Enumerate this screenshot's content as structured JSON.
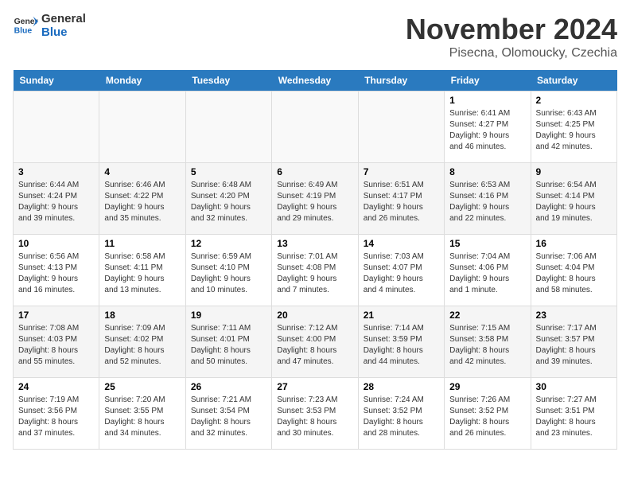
{
  "logo": {
    "line1": "General",
    "line2": "Blue"
  },
  "title": "November 2024",
  "subtitle": "Pisecna, Olomoucky, Czechia",
  "weekdays": [
    "Sunday",
    "Monday",
    "Tuesday",
    "Wednesday",
    "Thursday",
    "Friday",
    "Saturday"
  ],
  "weeks": [
    [
      {
        "day": "",
        "info": ""
      },
      {
        "day": "",
        "info": ""
      },
      {
        "day": "",
        "info": ""
      },
      {
        "day": "",
        "info": ""
      },
      {
        "day": "",
        "info": ""
      },
      {
        "day": "1",
        "info": "Sunrise: 6:41 AM\nSunset: 4:27 PM\nDaylight: 9 hours\nand 46 minutes."
      },
      {
        "day": "2",
        "info": "Sunrise: 6:43 AM\nSunset: 4:25 PM\nDaylight: 9 hours\nand 42 minutes."
      }
    ],
    [
      {
        "day": "3",
        "info": "Sunrise: 6:44 AM\nSunset: 4:24 PM\nDaylight: 9 hours\nand 39 minutes."
      },
      {
        "day": "4",
        "info": "Sunrise: 6:46 AM\nSunset: 4:22 PM\nDaylight: 9 hours\nand 35 minutes."
      },
      {
        "day": "5",
        "info": "Sunrise: 6:48 AM\nSunset: 4:20 PM\nDaylight: 9 hours\nand 32 minutes."
      },
      {
        "day": "6",
        "info": "Sunrise: 6:49 AM\nSunset: 4:19 PM\nDaylight: 9 hours\nand 29 minutes."
      },
      {
        "day": "7",
        "info": "Sunrise: 6:51 AM\nSunset: 4:17 PM\nDaylight: 9 hours\nand 26 minutes."
      },
      {
        "day": "8",
        "info": "Sunrise: 6:53 AM\nSunset: 4:16 PM\nDaylight: 9 hours\nand 22 minutes."
      },
      {
        "day": "9",
        "info": "Sunrise: 6:54 AM\nSunset: 4:14 PM\nDaylight: 9 hours\nand 19 minutes."
      }
    ],
    [
      {
        "day": "10",
        "info": "Sunrise: 6:56 AM\nSunset: 4:13 PM\nDaylight: 9 hours\nand 16 minutes."
      },
      {
        "day": "11",
        "info": "Sunrise: 6:58 AM\nSunset: 4:11 PM\nDaylight: 9 hours\nand 13 minutes."
      },
      {
        "day": "12",
        "info": "Sunrise: 6:59 AM\nSunset: 4:10 PM\nDaylight: 9 hours\nand 10 minutes."
      },
      {
        "day": "13",
        "info": "Sunrise: 7:01 AM\nSunset: 4:08 PM\nDaylight: 9 hours\nand 7 minutes."
      },
      {
        "day": "14",
        "info": "Sunrise: 7:03 AM\nSunset: 4:07 PM\nDaylight: 9 hours\nand 4 minutes."
      },
      {
        "day": "15",
        "info": "Sunrise: 7:04 AM\nSunset: 4:06 PM\nDaylight: 9 hours\nand 1 minute."
      },
      {
        "day": "16",
        "info": "Sunrise: 7:06 AM\nSunset: 4:04 PM\nDaylight: 8 hours\nand 58 minutes."
      }
    ],
    [
      {
        "day": "17",
        "info": "Sunrise: 7:08 AM\nSunset: 4:03 PM\nDaylight: 8 hours\nand 55 minutes."
      },
      {
        "day": "18",
        "info": "Sunrise: 7:09 AM\nSunset: 4:02 PM\nDaylight: 8 hours\nand 52 minutes."
      },
      {
        "day": "19",
        "info": "Sunrise: 7:11 AM\nSunset: 4:01 PM\nDaylight: 8 hours\nand 50 minutes."
      },
      {
        "day": "20",
        "info": "Sunrise: 7:12 AM\nSunset: 4:00 PM\nDaylight: 8 hours\nand 47 minutes."
      },
      {
        "day": "21",
        "info": "Sunrise: 7:14 AM\nSunset: 3:59 PM\nDaylight: 8 hours\nand 44 minutes."
      },
      {
        "day": "22",
        "info": "Sunrise: 7:15 AM\nSunset: 3:58 PM\nDaylight: 8 hours\nand 42 minutes."
      },
      {
        "day": "23",
        "info": "Sunrise: 7:17 AM\nSunset: 3:57 PM\nDaylight: 8 hours\nand 39 minutes."
      }
    ],
    [
      {
        "day": "24",
        "info": "Sunrise: 7:19 AM\nSunset: 3:56 PM\nDaylight: 8 hours\nand 37 minutes."
      },
      {
        "day": "25",
        "info": "Sunrise: 7:20 AM\nSunset: 3:55 PM\nDaylight: 8 hours\nand 34 minutes."
      },
      {
        "day": "26",
        "info": "Sunrise: 7:21 AM\nSunset: 3:54 PM\nDaylight: 8 hours\nand 32 minutes."
      },
      {
        "day": "27",
        "info": "Sunrise: 7:23 AM\nSunset: 3:53 PM\nDaylight: 8 hours\nand 30 minutes."
      },
      {
        "day": "28",
        "info": "Sunrise: 7:24 AM\nSunset: 3:52 PM\nDaylight: 8 hours\nand 28 minutes."
      },
      {
        "day": "29",
        "info": "Sunrise: 7:26 AM\nSunset: 3:52 PM\nDaylight: 8 hours\nand 26 minutes."
      },
      {
        "day": "30",
        "info": "Sunrise: 7:27 AM\nSunset: 3:51 PM\nDaylight: 8 hours\nand 23 minutes."
      }
    ]
  ]
}
